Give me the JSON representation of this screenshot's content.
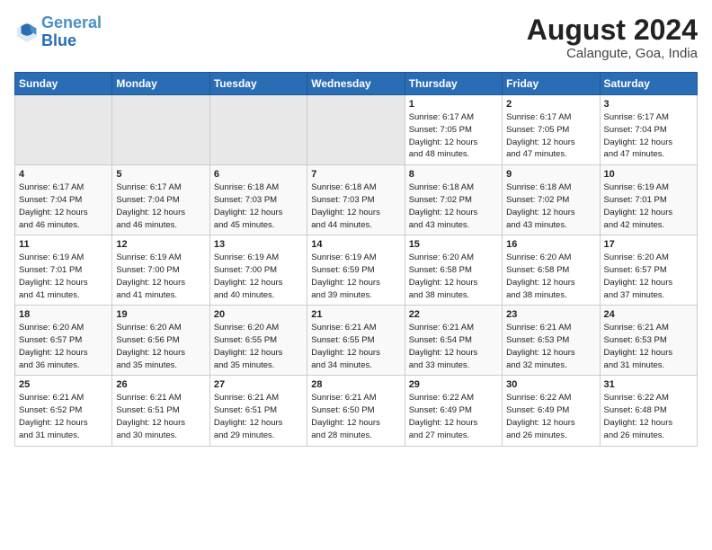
{
  "header": {
    "logo_line1": "General",
    "logo_line2": "Blue",
    "month": "August 2024",
    "location": "Calangute, Goa, India"
  },
  "weekdays": [
    "Sunday",
    "Monday",
    "Tuesday",
    "Wednesday",
    "Thursday",
    "Friday",
    "Saturday"
  ],
  "weeks": [
    [
      {
        "day": "",
        "info": ""
      },
      {
        "day": "",
        "info": ""
      },
      {
        "day": "",
        "info": ""
      },
      {
        "day": "",
        "info": ""
      },
      {
        "day": "1",
        "info": "Sunrise: 6:17 AM\nSunset: 7:05 PM\nDaylight: 12 hours\nand 48 minutes."
      },
      {
        "day": "2",
        "info": "Sunrise: 6:17 AM\nSunset: 7:05 PM\nDaylight: 12 hours\nand 47 minutes."
      },
      {
        "day": "3",
        "info": "Sunrise: 6:17 AM\nSunset: 7:04 PM\nDaylight: 12 hours\nand 47 minutes."
      }
    ],
    [
      {
        "day": "4",
        "info": "Sunrise: 6:17 AM\nSunset: 7:04 PM\nDaylight: 12 hours\nand 46 minutes."
      },
      {
        "day": "5",
        "info": "Sunrise: 6:17 AM\nSunset: 7:04 PM\nDaylight: 12 hours\nand 46 minutes."
      },
      {
        "day": "6",
        "info": "Sunrise: 6:18 AM\nSunset: 7:03 PM\nDaylight: 12 hours\nand 45 minutes."
      },
      {
        "day": "7",
        "info": "Sunrise: 6:18 AM\nSunset: 7:03 PM\nDaylight: 12 hours\nand 44 minutes."
      },
      {
        "day": "8",
        "info": "Sunrise: 6:18 AM\nSunset: 7:02 PM\nDaylight: 12 hours\nand 43 minutes."
      },
      {
        "day": "9",
        "info": "Sunrise: 6:18 AM\nSunset: 7:02 PM\nDaylight: 12 hours\nand 43 minutes."
      },
      {
        "day": "10",
        "info": "Sunrise: 6:19 AM\nSunset: 7:01 PM\nDaylight: 12 hours\nand 42 minutes."
      }
    ],
    [
      {
        "day": "11",
        "info": "Sunrise: 6:19 AM\nSunset: 7:01 PM\nDaylight: 12 hours\nand 41 minutes."
      },
      {
        "day": "12",
        "info": "Sunrise: 6:19 AM\nSunset: 7:00 PM\nDaylight: 12 hours\nand 41 minutes."
      },
      {
        "day": "13",
        "info": "Sunrise: 6:19 AM\nSunset: 7:00 PM\nDaylight: 12 hours\nand 40 minutes."
      },
      {
        "day": "14",
        "info": "Sunrise: 6:19 AM\nSunset: 6:59 PM\nDaylight: 12 hours\nand 39 minutes."
      },
      {
        "day": "15",
        "info": "Sunrise: 6:20 AM\nSunset: 6:58 PM\nDaylight: 12 hours\nand 38 minutes."
      },
      {
        "day": "16",
        "info": "Sunrise: 6:20 AM\nSunset: 6:58 PM\nDaylight: 12 hours\nand 38 minutes."
      },
      {
        "day": "17",
        "info": "Sunrise: 6:20 AM\nSunset: 6:57 PM\nDaylight: 12 hours\nand 37 minutes."
      }
    ],
    [
      {
        "day": "18",
        "info": "Sunrise: 6:20 AM\nSunset: 6:57 PM\nDaylight: 12 hours\nand 36 minutes."
      },
      {
        "day": "19",
        "info": "Sunrise: 6:20 AM\nSunset: 6:56 PM\nDaylight: 12 hours\nand 35 minutes."
      },
      {
        "day": "20",
        "info": "Sunrise: 6:20 AM\nSunset: 6:55 PM\nDaylight: 12 hours\nand 35 minutes."
      },
      {
        "day": "21",
        "info": "Sunrise: 6:21 AM\nSunset: 6:55 PM\nDaylight: 12 hours\nand 34 minutes."
      },
      {
        "day": "22",
        "info": "Sunrise: 6:21 AM\nSunset: 6:54 PM\nDaylight: 12 hours\nand 33 minutes."
      },
      {
        "day": "23",
        "info": "Sunrise: 6:21 AM\nSunset: 6:53 PM\nDaylight: 12 hours\nand 32 minutes."
      },
      {
        "day": "24",
        "info": "Sunrise: 6:21 AM\nSunset: 6:53 PM\nDaylight: 12 hours\nand 31 minutes."
      }
    ],
    [
      {
        "day": "25",
        "info": "Sunrise: 6:21 AM\nSunset: 6:52 PM\nDaylight: 12 hours\nand 31 minutes."
      },
      {
        "day": "26",
        "info": "Sunrise: 6:21 AM\nSunset: 6:51 PM\nDaylight: 12 hours\nand 30 minutes."
      },
      {
        "day": "27",
        "info": "Sunrise: 6:21 AM\nSunset: 6:51 PM\nDaylight: 12 hours\nand 29 minutes."
      },
      {
        "day": "28",
        "info": "Sunrise: 6:21 AM\nSunset: 6:50 PM\nDaylight: 12 hours\nand 28 minutes."
      },
      {
        "day": "29",
        "info": "Sunrise: 6:22 AM\nSunset: 6:49 PM\nDaylight: 12 hours\nand 27 minutes."
      },
      {
        "day": "30",
        "info": "Sunrise: 6:22 AM\nSunset: 6:49 PM\nDaylight: 12 hours\nand 26 minutes."
      },
      {
        "day": "31",
        "info": "Sunrise: 6:22 AM\nSunset: 6:48 PM\nDaylight: 12 hours\nand 26 minutes."
      }
    ]
  ]
}
